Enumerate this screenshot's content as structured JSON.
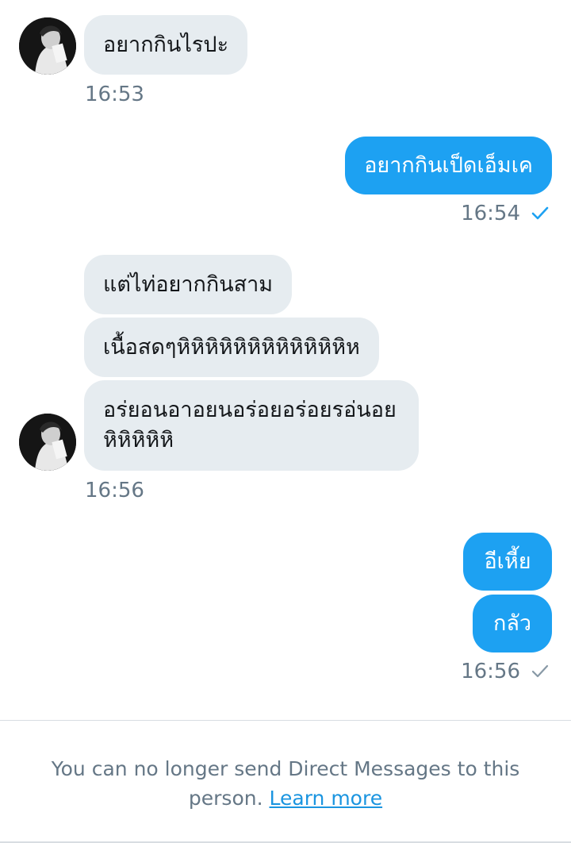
{
  "messages": {
    "m1": "อยากกินไรปะ",
    "t1": "16:53",
    "m2": "อยากกินเป็ดเอ็มเค",
    "t2": "16:54",
    "m3": "แต่ไท่อยากกินสาม",
    "m4": "เนื้อสดๆหิหิหิหิหิหิหิหิหิหิหิหิห",
    "m5": "อร่ยอนอาอยนอร่อยอร่อยรอ่นอย หิหิหิหิหิ",
    "t3": "16:56",
    "m6": "อีเหี้ย",
    "m7": "กลัว",
    "t4": "16:56"
  },
  "notice": {
    "text": "You can no longer send Direct Messages to this person.",
    "link": "Learn more"
  },
  "colors": {
    "outgoing_bubble": "#1da1f2",
    "incoming_bubble": "#e6ecf0",
    "read_check": "#1da1f2",
    "sent_check": "#8899a6",
    "link": "#1b95e0"
  },
  "icons": {
    "read": "check-icon",
    "sent": "check-icon"
  }
}
